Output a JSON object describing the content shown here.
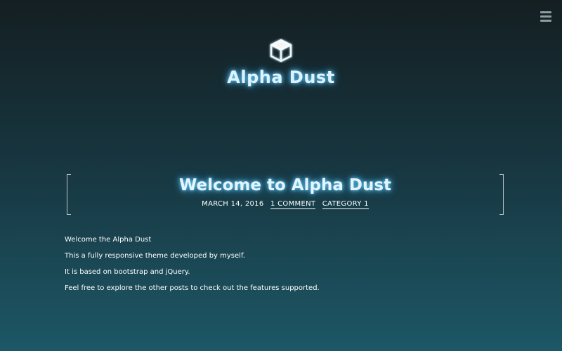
{
  "site": {
    "title": "Alpha Dust",
    "logo_icon": "cube-icon"
  },
  "nav": {
    "menu_icon": "hamburger-menu-icon"
  },
  "post": {
    "title": "Welcome to Alpha Dust",
    "date": "MARCH 14, 2016",
    "comments": "1 COMMENT",
    "category": "CATEGORY 1",
    "paragraphs": [
      "Welcome the Alpha Dust",
      "This a fully responsive theme developed by myself.",
      "It is based on bootstrap and jQuery.",
      "Feel free to explore the other posts to check out the features supported."
    ]
  },
  "colors": {
    "glow": "#6fd4ff",
    "bg_top": "#141f22",
    "bg_bottom": "#1d5766"
  }
}
